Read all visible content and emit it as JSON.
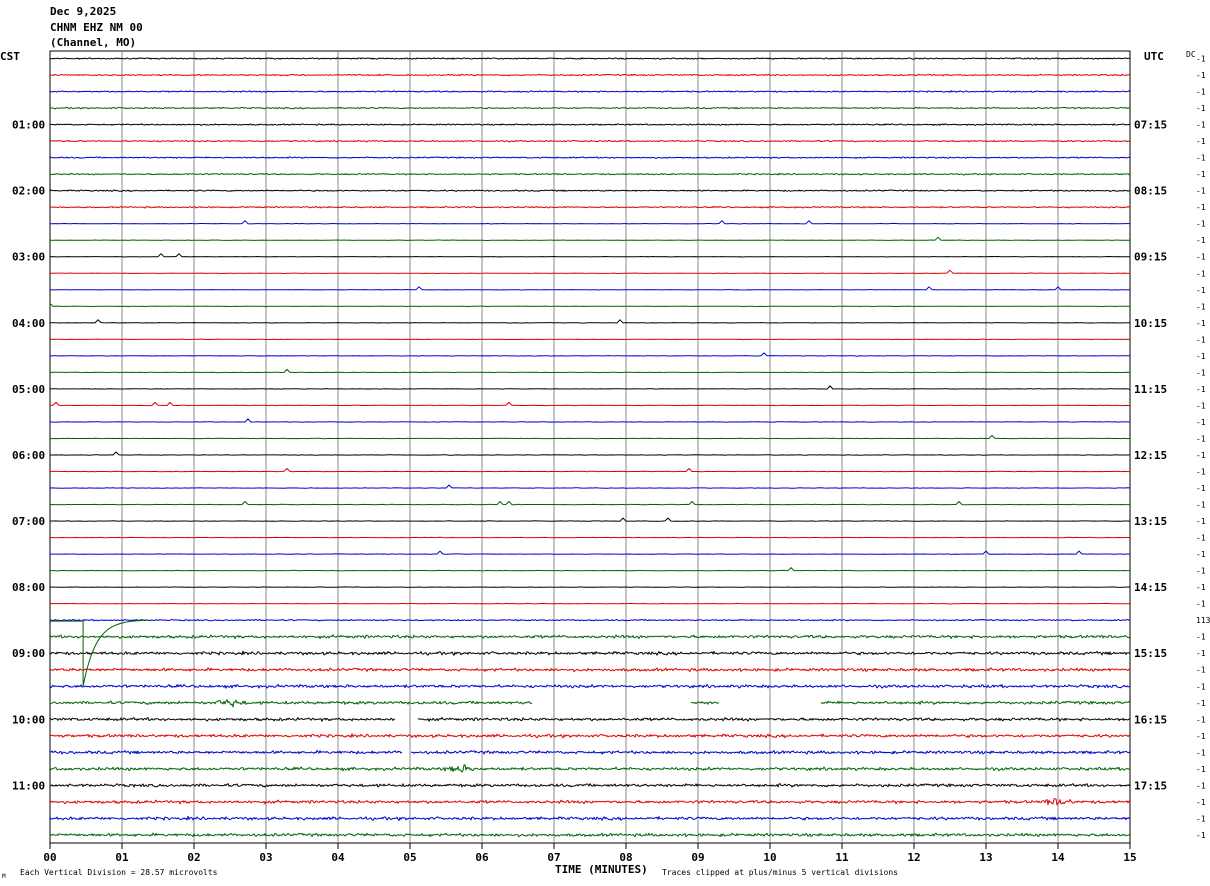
{
  "header": {
    "date": "Dec 9,2025",
    "station": "CHNM EHZ NM 00",
    "channel": "(Channel, MO)"
  },
  "left_tz": "CST",
  "right_tz": "UTC",
  "dc_label": "DC",
  "footer": {
    "left_note": "Each Vertical Division =   28.57 microvolts",
    "corner_mark": "M",
    "xlabel": "TIME (MINUTES)",
    "right_note": "Traces clipped at plus/minus 5 vertical divisions"
  },
  "chart_data": {
    "type": "line",
    "title": "CHNM EHZ NM 00",
    "xlabel": "TIME (MINUTES)",
    "xlim": [
      0,
      15
    ],
    "x_ticks": [
      "00",
      "01",
      "02",
      "03",
      "04",
      "05",
      "06",
      "07",
      "08",
      "09",
      "10",
      "11",
      "12",
      "13",
      "14",
      "15"
    ],
    "row_count": 48,
    "row_minutes": 15,
    "trace_colors": [
      "#000000",
      "#e00000",
      "#0000d0",
      "#006400"
    ],
    "left_hour_labels": [
      "01:00",
      "02:00",
      "03:00",
      "04:00",
      "05:00",
      "06:00",
      "07:00",
      "08:00",
      "09:00",
      "10:00",
      "11:00"
    ],
    "right_hour_labels": [
      "07:15",
      "08:15",
      "09:15",
      "10:15",
      "11:15",
      "12:15",
      "13:15",
      "14:15",
      "15:15",
      "16:15",
      "17:15"
    ],
    "dc_offsets": [
      "-1",
      "-1",
      "-1",
      "-1",
      "-1",
      "-1",
      "-1",
      "-1",
      "-1",
      "-1",
      "-1",
      "-1",
      "-1",
      "-1",
      "-1",
      "-1",
      "-1",
      "-1",
      "-1",
      "-1",
      "-1",
      "-1",
      "-1",
      "-1",
      "-1",
      "-1",
      "-1",
      "-1",
      "-1",
      "-1",
      "-1",
      "-1",
      "-1",
      "-1",
      "113",
      "-1",
      "-1",
      "-1",
      "-1",
      "-1",
      "-1",
      "-1",
      "-1",
      "-1",
      "-1",
      "-1",
      "-1",
      "-1"
    ],
    "row_activity": [
      1,
      1,
      1,
      1,
      1,
      1,
      1,
      1,
      1,
      1,
      0,
      0,
      0,
      0,
      0,
      0,
      0,
      0,
      0,
      0,
      0,
      0,
      0,
      0,
      0,
      0,
      0,
      0,
      0,
      0,
      0,
      0,
      0,
      0,
      1,
      2,
      2,
      2,
      2,
      2,
      2,
      2,
      2,
      2,
      2,
      2,
      2,
      2
    ],
    "gaps_minutes": {
      "39": [
        [
          6.7,
          8.9
        ],
        [
          9.3,
          10.7
        ]
      ],
      "40": [
        [
          4.8,
          5.1
        ]
      ],
      "42": [
        [
          4.9,
          5.0
        ]
      ]
    },
    "events": [
      {
        "row": 39,
        "minute": 2.5,
        "label": ""
      },
      {
        "row": 43,
        "minute": 5.7,
        "label": ""
      },
      {
        "row": 45,
        "minute": 14.0,
        "label": ""
      }
    ],
    "annotations": [
      "Each Vertical Division =   28.57 microvolts",
      "Traces clipped at plus/minus 5 vertical divisions"
    ]
  }
}
